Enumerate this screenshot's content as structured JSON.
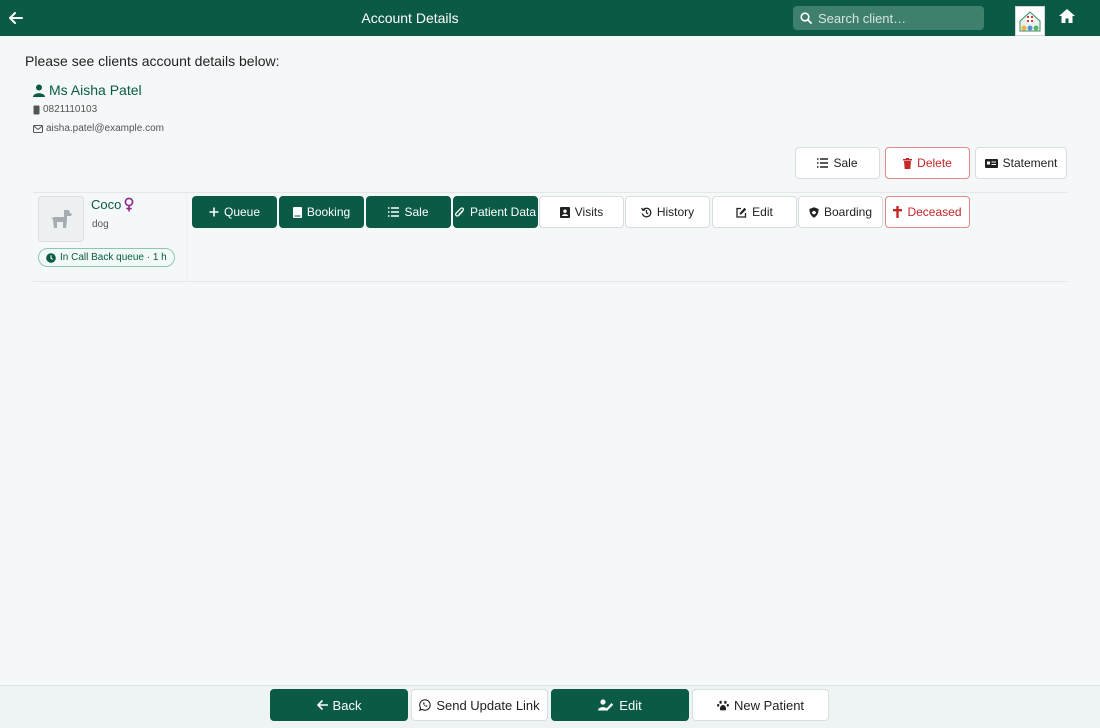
{
  "header": {
    "title": "Account Details",
    "search_placeholder": "Search client…"
  },
  "intro": "Please see clients account details below:",
  "client": {
    "name": "Ms Aisha Patel",
    "phone": "0821110103",
    "email": "aisha.patel@example.com"
  },
  "account_actions": {
    "sale": "Sale",
    "delete": "Delete",
    "statement": "Statement"
  },
  "patient": {
    "name": "Coco",
    "species": "dog",
    "status": "In Call Back queue · 1 h",
    "actions": {
      "queue": "Queue",
      "booking": "Booking",
      "sale": "Sale",
      "patient_data": "Patient Data",
      "visits": "Visits",
      "history": "History",
      "edit": "Edit",
      "boarding": "Boarding",
      "deceased": "Deceased"
    }
  },
  "footer": {
    "back": "Back",
    "send_update_link": "Send Update Link",
    "edit": "Edit",
    "new_patient": "New Patient"
  },
  "colors": {
    "brand_green": "#0a5a46",
    "danger_red": "#c52626",
    "female_purple": "#8a2a8f"
  }
}
